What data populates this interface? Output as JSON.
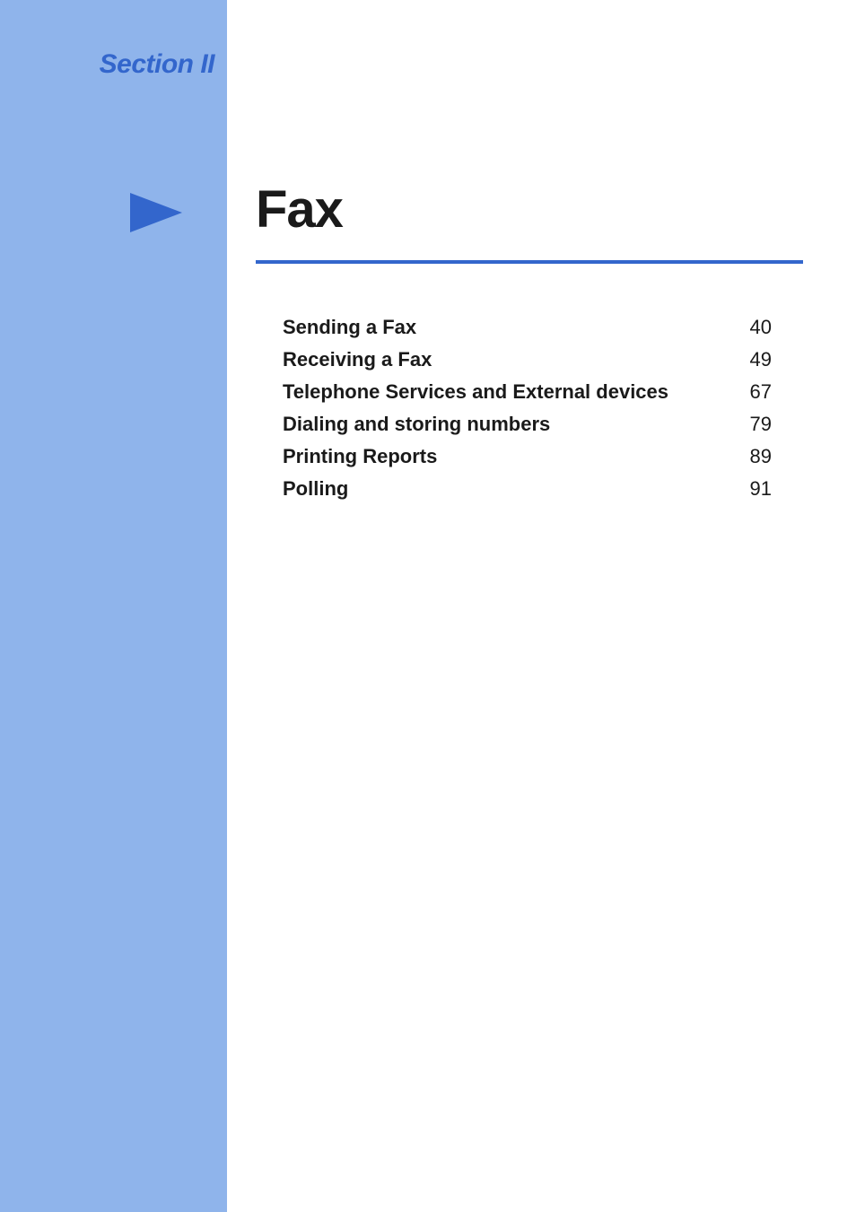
{
  "sidebar": {
    "section_label": "Section II"
  },
  "main": {
    "title": "Fax"
  },
  "toc": {
    "items": [
      {
        "title": "Sending a Fax",
        "page": "40"
      },
      {
        "title": "Receiving a Fax",
        "page": "49"
      },
      {
        "title": "Telephone Services and External devices",
        "page": "67"
      },
      {
        "title": "Dialing and storing numbers",
        "page": "79"
      },
      {
        "title": "Printing Reports",
        "page": "89"
      },
      {
        "title": "Polling",
        "page": "91"
      }
    ]
  }
}
